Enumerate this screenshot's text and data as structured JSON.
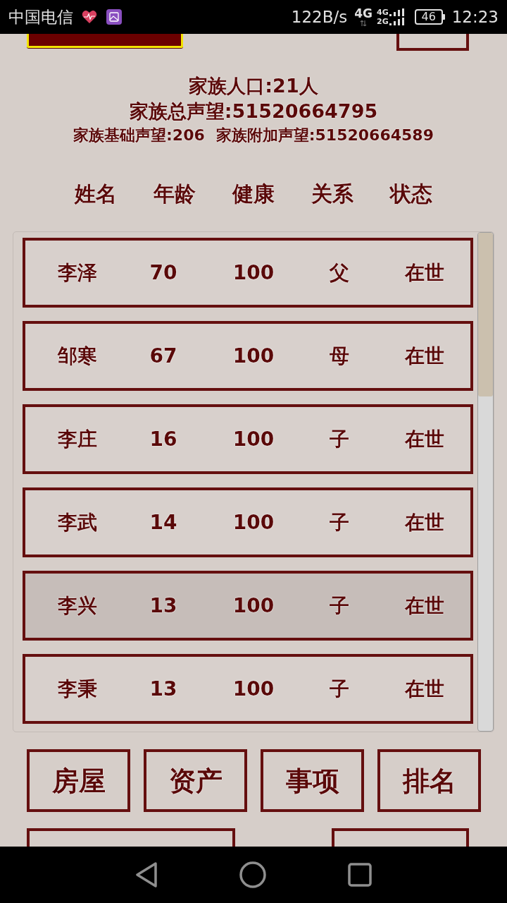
{
  "status_bar": {
    "carrier": "中国电信",
    "net_speed": "122B/s",
    "network": "4G",
    "sim_1": "4G",
    "sim_2": "2G",
    "battery": "46",
    "time": "12:23"
  },
  "summary": {
    "population": "家族人口:21人",
    "total_prestige": "家族总声望:51520664795",
    "base_prestige": "家族基础声望:206",
    "extra_prestige": "家族附加声望:51520664589"
  },
  "table": {
    "columns": [
      "姓名",
      "年龄",
      "健康",
      "关系",
      "状态"
    ],
    "rows": [
      {
        "cells": [
          "李泽",
          "70",
          "100",
          "父",
          "在世"
        ],
        "selected": false
      },
      {
        "cells": [
          "邹寒",
          "67",
          "100",
          "母",
          "在世"
        ],
        "selected": false
      },
      {
        "cells": [
          "李庄",
          "16",
          "100",
          "子",
          "在世"
        ],
        "selected": false
      },
      {
        "cells": [
          "李武",
          "14",
          "100",
          "子",
          "在世"
        ],
        "selected": false
      },
      {
        "cells": [
          "李兴",
          "13",
          "100",
          "子",
          "在世"
        ],
        "selected": true
      },
      {
        "cells": [
          "李秉",
          "13",
          "100",
          "子",
          "在世"
        ],
        "selected": false
      }
    ]
  },
  "buttons": [
    "房屋",
    "资产",
    "事项",
    "排名"
  ]
}
